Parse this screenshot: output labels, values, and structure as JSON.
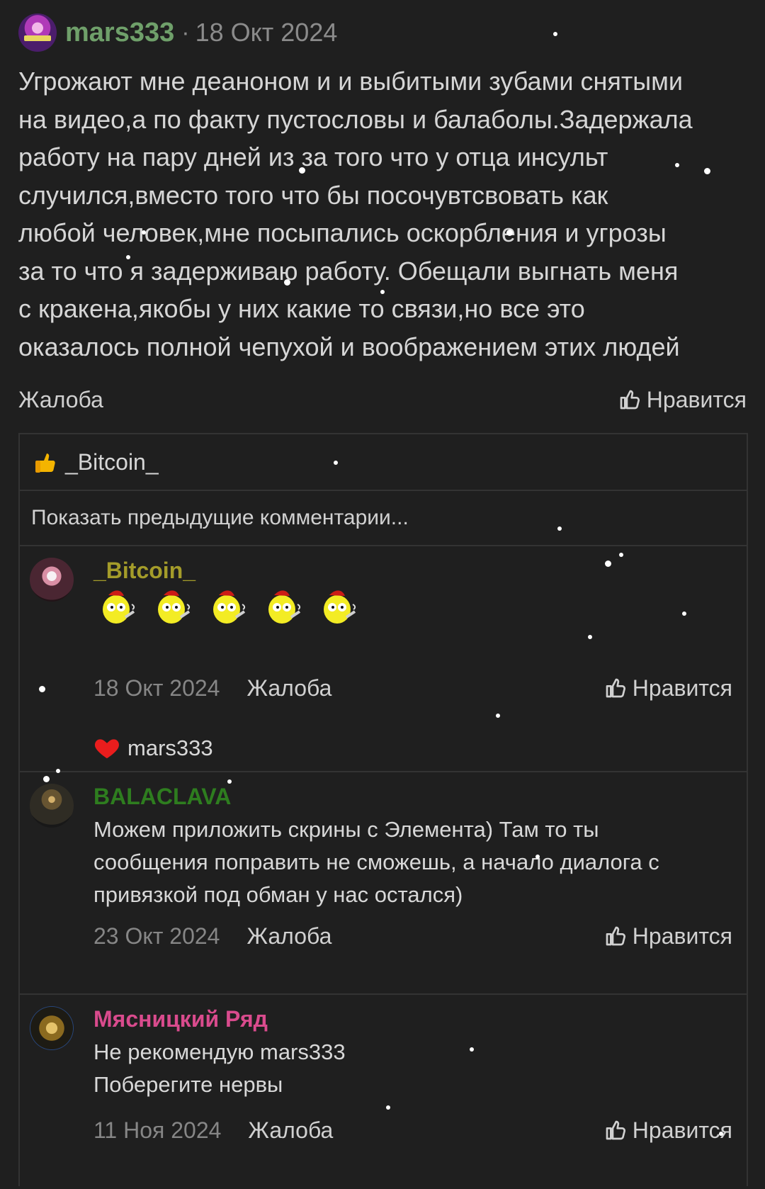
{
  "post": {
    "username": "mars333",
    "username_color": "#6fa06a",
    "separator": "·",
    "date": "18 Окт 2024",
    "text": "Угрожают мне деаноном и и выбитыми зубами снятыми\nна видео,а по факту пустословы и балаболы.Задержала\nработу на пару дней из за того что у отца инсульт\nслучился,вместо того что бы посочувтсвовать как\nлюбой человек,мне посыпались оскорбления и угрозы\nза то что я задерживаю работу. Обещали выгнать меня\nс кракена,якобы у них какие то связи,но все это\nоказалось полной чепухой и воображением этих людей",
    "report_label": "Жалоба",
    "like_label": "Нравится",
    "like_icon": "thumbs-up-outline-icon"
  },
  "comments_section": {
    "liked_by": {
      "icon": "thumbs-up-emoji-icon",
      "name": "_Bitcoin_"
    },
    "show_previous_label": "Показать предыдущие комментарии...",
    "comments": [
      {
        "username": "_Bitcoin_",
        "username_color": "#a49c2a",
        "avatar": "duracell-magic-avatar",
        "emoji_count": 5,
        "date": "18 Окт 2024",
        "report_label": "Жалоба",
        "like_label": "Нравится",
        "liked_by_icon": "heart-icon",
        "liked_by_name": "mars333"
      },
      {
        "username": "BALACLAVA",
        "username_color": "#2e7d1f",
        "avatar": "balaclava-avatar",
        "text": "Можем приложить скрины с Элемента) Там то ты\nсообщения поправить не сможешь, а начало диалога с\nпривязкой под обман у нас остался)",
        "date": "23 Окт 2024",
        "report_label": "Жалоба",
        "like_label": "Нравится"
      },
      {
        "username": "Мясницкий Ряд",
        "username_color": "#d94b8d",
        "avatar": "myasnitsky-ryad-avatar",
        "text": "Не рекомендую mars333\nПоберегите нервы",
        "date": "11 Ноя 2024",
        "report_label": "Жалоба",
        "like_label": "Нравится"
      }
    ]
  },
  "theme": {
    "background": "#1f1f1f",
    "text": "#d6d6d6",
    "muted": "#868686",
    "border": "#333333",
    "snow": "#ffffff"
  }
}
